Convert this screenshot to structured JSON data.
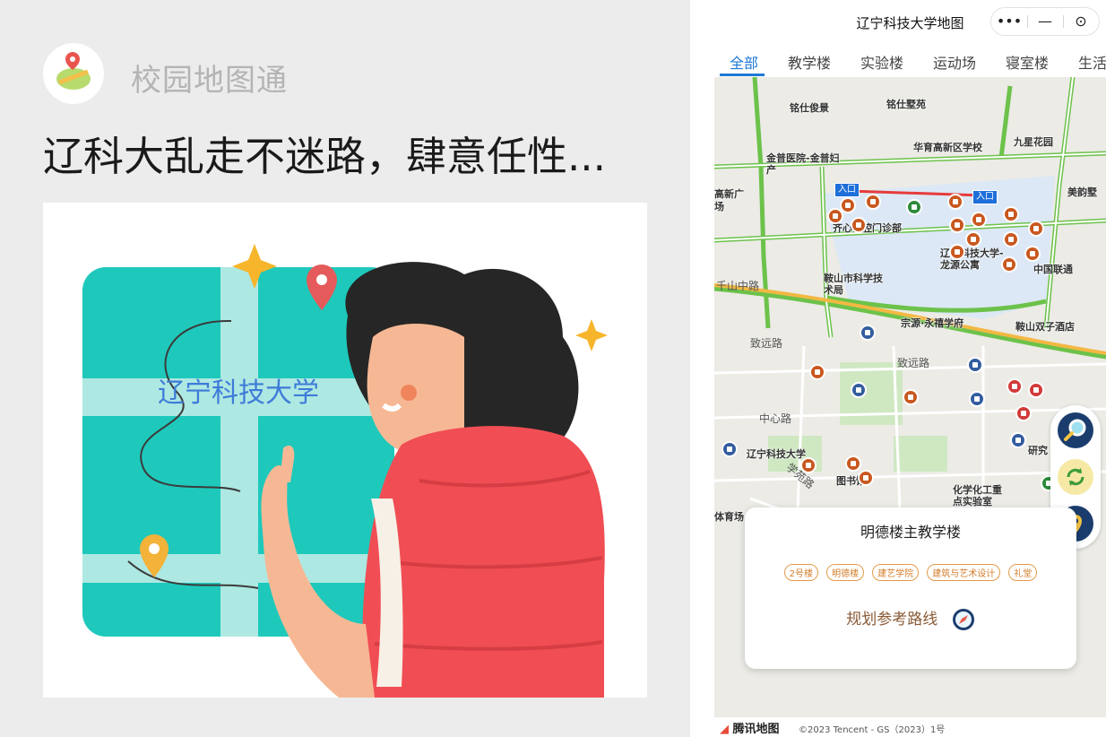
{
  "share_card": {
    "brand_name": "校园地图通",
    "headline": "辽科大乱走不迷路，肆意任性...",
    "hero_map_text": "辽宁科技大学"
  },
  "mini_program": {
    "title": "辽宁科技大学地图",
    "capsule": {
      "more": "•••",
      "minimize": "—",
      "close": "⊙"
    },
    "tabs": [
      {
        "label": "全部",
        "active": true
      },
      {
        "label": "教学楼",
        "active": false
      },
      {
        "label": "实验楼",
        "active": false
      },
      {
        "label": "运动场",
        "active": false
      },
      {
        "label": "寝室楼",
        "active": false
      },
      {
        "label": "生活",
        "active": false
      }
    ],
    "map_labels": {
      "mingshi_junyuan": "铭仕俊景",
      "mingshi_shuyuan": "铭仕墅苑",
      "jiuxing_garden": "九星花园",
      "huayu_school": "华育高新区学校",
      "jinpu_hospital": "金普医院-金普妇产",
      "gaoxin_square": "高新广场",
      "meiyun": "美韵墅",
      "entry_label": "入口",
      "qixin_clinic": "齐心口腔门诊部",
      "ustl_longyuan": "辽宁科技大学-龙源公寓",
      "china_unicom": "中国联通",
      "anshan_sci_bureau": "鞍山市科学技术局",
      "qianshan_road": "千山中路",
      "zongyuan": "宗源·永禧学府",
      "twin_hotel": "鞍山双子酒店",
      "zhiyuan_road": "致远路",
      "zhiyuan_road_2": "致远路",
      "zhongxin_road": "中心路",
      "ustl_main": "辽宁科技大学",
      "library": "图书馆",
      "chem_lab": "化学化工重点实验室",
      "research": "研究",
      "xueyuan_road": "学苑路",
      "sports_field": "体育场"
    },
    "selected_building": {
      "name": "明德楼主教学楼",
      "tags": [
        "2号楼",
        "明德楼",
        "建艺学院",
        "建筑与艺术设计",
        "礼堂"
      ],
      "route_label": "规划参考路线"
    },
    "footer": {
      "provider": "腾讯地图",
      "copyright": "©2023 Tencent - GS（2023）1号"
    },
    "colors": {
      "accent": "#1e78d6",
      "road": "#6cc24a",
      "route_text": "#8a5a36"
    }
  }
}
